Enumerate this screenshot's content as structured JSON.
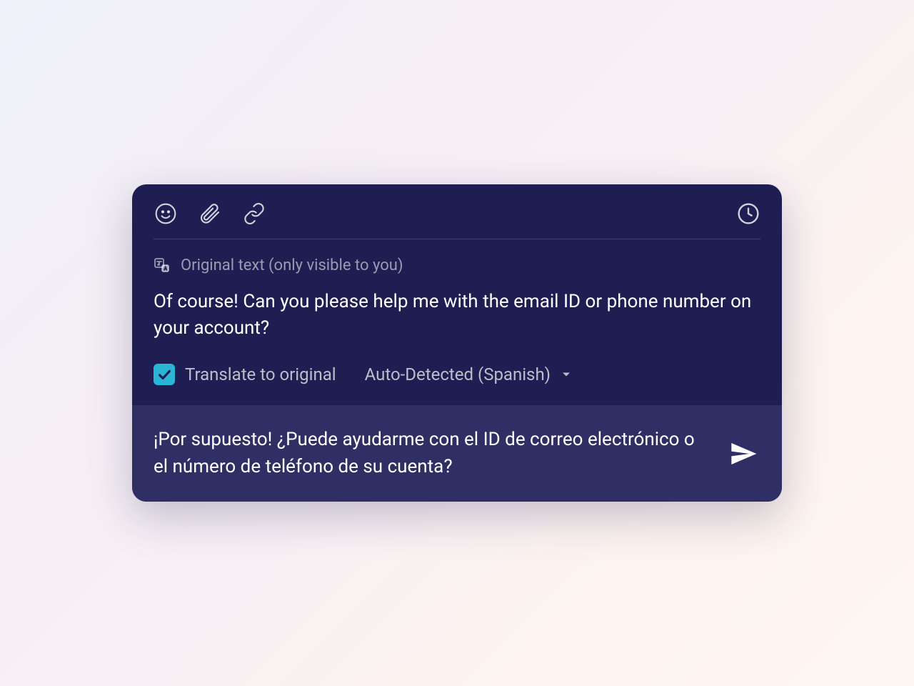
{
  "header": {
    "hint": "Original text (only visible to you)"
  },
  "compose": {
    "original_text": "Of course! Can you please help me with the email ID or phone number on your account?",
    "translated_text": "¡Por supuesto! ¿Puede ayudarme con el ID de correo electrónico o el número de teléfono de su cuenta?"
  },
  "controls": {
    "translate_label": "Translate to original",
    "language_selector": "Auto-Detected (Spanish)"
  }
}
